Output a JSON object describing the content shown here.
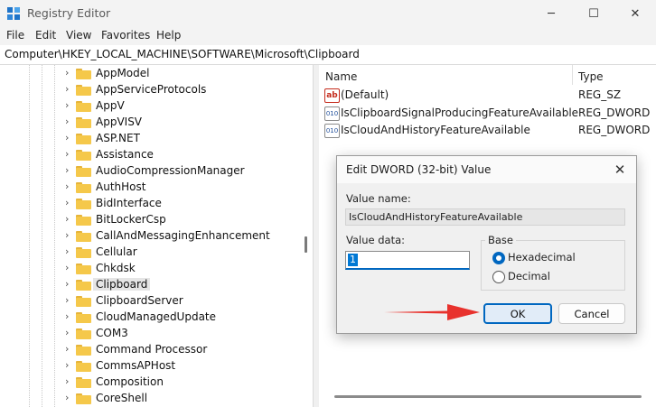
{
  "window": {
    "title": "Registry Editor",
    "minimize": "─",
    "maximize": "☐",
    "close": "✕"
  },
  "menu": [
    "File",
    "Edit",
    "View",
    "Favorites",
    "Help"
  ],
  "address": "Computer\\HKEY_LOCAL_MACHINE\\SOFTWARE\\Microsoft\\Clipboard",
  "tree": [
    {
      "label": "AppModel",
      "selected": false
    },
    {
      "label": "AppServiceProtocols",
      "selected": false
    },
    {
      "label": "AppV",
      "selected": false
    },
    {
      "label": "AppVISV",
      "selected": false
    },
    {
      "label": "ASP.NET",
      "selected": false
    },
    {
      "label": "Assistance",
      "selected": false
    },
    {
      "label": "AudioCompressionManager",
      "selected": false
    },
    {
      "label": "AuthHost",
      "selected": false
    },
    {
      "label": "BidInterface",
      "selected": false
    },
    {
      "label": "BitLockerCsp",
      "selected": false
    },
    {
      "label": "CallAndMessagingEnhancement",
      "selected": false
    },
    {
      "label": "Cellular",
      "selected": false
    },
    {
      "label": "Chkdsk",
      "selected": false
    },
    {
      "label": "Clipboard",
      "selected": true
    },
    {
      "label": "ClipboardServer",
      "selected": false
    },
    {
      "label": "CloudManagedUpdate",
      "selected": false
    },
    {
      "label": "COM3",
      "selected": false
    },
    {
      "label": "Command Processor",
      "selected": false
    },
    {
      "label": "CommsAPHost",
      "selected": false
    },
    {
      "label": "Composition",
      "selected": false
    },
    {
      "label": "CoreShell",
      "selected": false
    }
  ],
  "list": {
    "headers": {
      "name": "Name",
      "type": "Type"
    },
    "rows": [
      {
        "name": "(Default)",
        "type": "REG_SZ",
        "icon": "ab"
      },
      {
        "name": "IsClipboardSignalProducingFeatureAvailable",
        "type": "REG_DWORD",
        "icon": "010"
      },
      {
        "name": "IsCloudAndHistoryFeatureAvailable",
        "type": "REG_DWORD",
        "icon": "010"
      }
    ]
  },
  "dialog": {
    "title": "Edit DWORD (32-bit) Value",
    "close": "✕",
    "value_name_label": "Value name:",
    "value_name": "IsCloudAndHistoryFeatureAvailable",
    "value_data_label": "Value data:",
    "value_data": "1",
    "base_label": "Base",
    "hex_label": "Hexadecimal",
    "dec_label": "Decimal",
    "selected_base": "Hexadecimal",
    "ok": "OK",
    "cancel": "Cancel"
  },
  "colors": {
    "accent": "#0067c0",
    "arrow": "#e8322d",
    "folder": "#f5c84a"
  }
}
